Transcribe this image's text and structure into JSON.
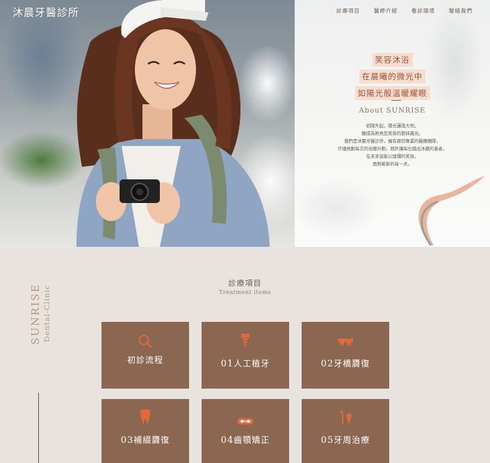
{
  "logo": "沐晨牙醫診所",
  "nav": [
    "診療項目",
    "醫師介紹",
    "看診環境",
    "聯絡我們"
  ],
  "tagline": [
    "笑容沐浴",
    "在晨曦的微光中",
    "如陽光般溫暖耀眼"
  ],
  "about": {
    "title": "About SUNRISE",
    "lines": [
      "初陽升起，陽光灑落大地，",
      "願成為照亮您笑容的那抹晨光。",
      "我們是沐晨牙醫診所，擁有親切專業的醫療團隊，",
      "仔細規劃每次的治療計劃，期許讓每位踏出沐晨的患者，",
      "在未來皆能以燦爛的笑容，",
      "面對嶄新的每一天。"
    ]
  },
  "brand_vertical": {
    "line1": "SUNRISE",
    "line2": "Dental-Clinic"
  },
  "section": {
    "title": "診療項目",
    "subtitle": "Treatment items"
  },
  "colors": {
    "card": "#8b6650",
    "accent": "#e2693f",
    "background": "#e8e3df",
    "tag_bg": "#f5ddd0"
  },
  "cards": [
    {
      "num": "",
      "label": "初診流程",
      "icon": "search-icon"
    },
    {
      "num": "01",
      "label": "人工植牙",
      "icon": "dental-implant-icon"
    },
    {
      "num": "02",
      "label": "牙橋贗復",
      "icon": "dental-bridge-icon"
    },
    {
      "num": "03",
      "label": "補綴贗復",
      "icon": "tooth-crown-icon"
    },
    {
      "num": "04",
      "label": "齒顎矯正",
      "icon": "braces-icon"
    },
    {
      "num": "05",
      "label": "牙周治療",
      "icon": "periodontal-tools-icon"
    }
  ]
}
